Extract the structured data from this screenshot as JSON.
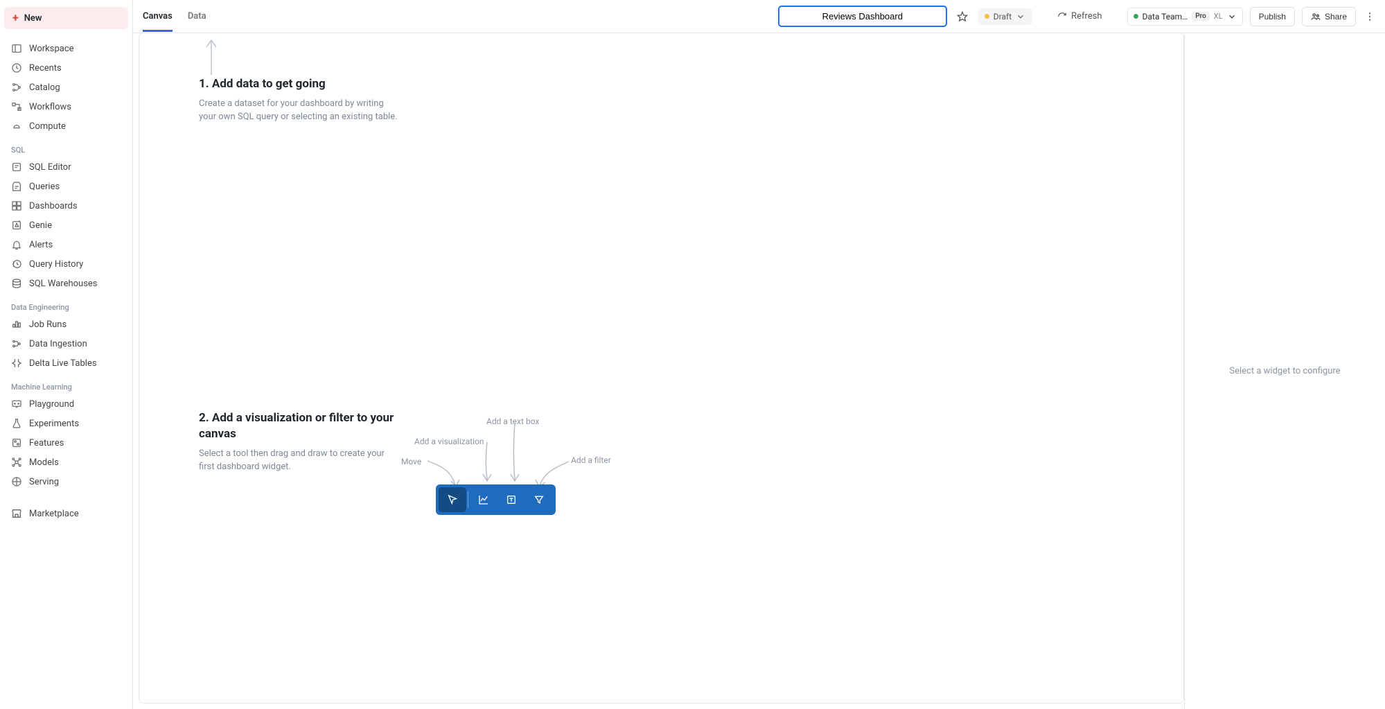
{
  "sidebar": {
    "new_label": "New",
    "main_items": [
      {
        "label": "Workspace",
        "name": "sidebar-item-workspace"
      },
      {
        "label": "Recents",
        "name": "sidebar-item-recents"
      },
      {
        "label": "Catalog",
        "name": "sidebar-item-catalog"
      },
      {
        "label": "Workflows",
        "name": "sidebar-item-workflows"
      },
      {
        "label": "Compute",
        "name": "sidebar-item-compute"
      }
    ],
    "sections": [
      {
        "title": "SQL",
        "items": [
          {
            "label": "SQL Editor",
            "name": "sidebar-item-sql-editor"
          },
          {
            "label": "Queries",
            "name": "sidebar-item-queries"
          },
          {
            "label": "Dashboards",
            "name": "sidebar-item-dashboards"
          },
          {
            "label": "Genie",
            "name": "sidebar-item-genie"
          },
          {
            "label": "Alerts",
            "name": "sidebar-item-alerts"
          },
          {
            "label": "Query History",
            "name": "sidebar-item-query-history"
          },
          {
            "label": "SQL Warehouses",
            "name": "sidebar-item-sql-warehouses"
          }
        ]
      },
      {
        "title": "Data Engineering",
        "items": [
          {
            "label": "Job Runs",
            "name": "sidebar-item-job-runs"
          },
          {
            "label": "Data Ingestion",
            "name": "sidebar-item-data-ingestion"
          },
          {
            "label": "Delta Live Tables",
            "name": "sidebar-item-delta-live-tables"
          }
        ]
      },
      {
        "title": "Machine Learning",
        "items": [
          {
            "label": "Playground",
            "name": "sidebar-item-playground"
          },
          {
            "label": "Experiments",
            "name": "sidebar-item-experiments"
          },
          {
            "label": "Features",
            "name": "sidebar-item-features"
          },
          {
            "label": "Models",
            "name": "sidebar-item-models"
          },
          {
            "label": "Serving",
            "name": "sidebar-item-serving"
          }
        ]
      }
    ],
    "marketplace_label": "Marketplace"
  },
  "topbar": {
    "tabs": [
      "Canvas",
      "Data"
    ],
    "title": "Reviews Dashboard",
    "status": "Draft",
    "refresh": "Refresh",
    "cluster": "Data Team…",
    "cluster_badge": "Pro",
    "cluster_size": "XL",
    "publish": "Publish",
    "share": "Share"
  },
  "canvas": {
    "step1_title": "1. Add data to get going",
    "step1_body": "Create a dataset for your dashboard by writing your own SQL query or selecting an existing table.",
    "step2_title": "2. Add a visualization or filter to your canvas",
    "step2_body": "Select a tool then drag and draw to create your first dashboard widget.",
    "hint_move": "Move",
    "hint_viz": "Add a visualization",
    "hint_text": "Add a text box",
    "hint_filter": "Add a filter"
  },
  "right_panel": {
    "empty_text": "Select a widget to configure"
  }
}
